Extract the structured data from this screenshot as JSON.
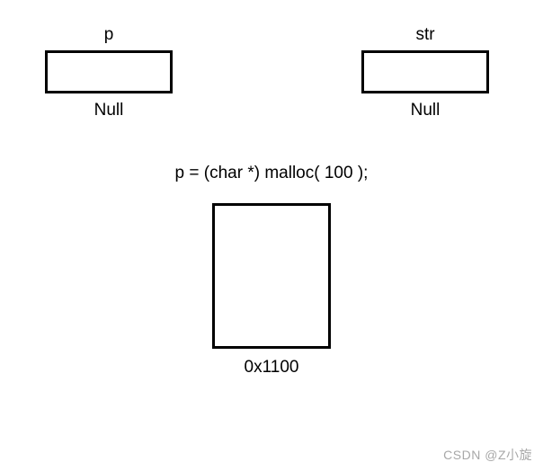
{
  "pointer_p": {
    "name": "p",
    "value": "Null"
  },
  "pointer_str": {
    "name": "str",
    "value": "Null"
  },
  "code": "p = (char *) malloc( 100 );",
  "memory": {
    "address": "0x1100"
  },
  "watermark": "CSDN @Z小旋"
}
